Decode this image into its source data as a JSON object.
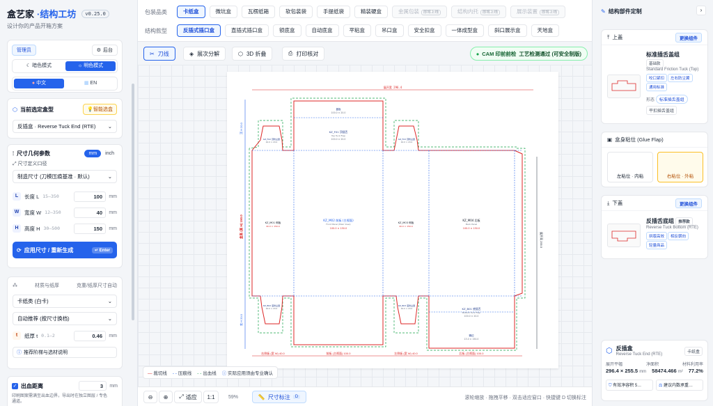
{
  "brand": {
    "name": "盒艺家",
    "product": "·结构工坊",
    "version": "v0.25.0",
    "subtitle": "设计你的产品开箱方案"
  },
  "left": {
    "role": "管理员",
    "backstage": "后台",
    "theme": {
      "dark": "暗色模式",
      "light": "明色模式"
    },
    "lang": {
      "zh": "中文",
      "en": "EN"
    },
    "current_box": {
      "title": "当前选定盒型",
      "smart": "智能选盒",
      "value": "反插盒 · Reverse Tuck End (RTE)"
    },
    "dims": {
      "title": "尺寸几何参数",
      "unit_mm": "mm",
      "unit_inch": "inch",
      "def_label": "尺寸定义口径",
      "def_value": "制造尺寸 (刀模压痕基准 · 默认)",
      "rows": [
        {
          "key": "L",
          "name": "长度 L",
          "range": "15–350",
          "value": "100",
          "unit": "mm"
        },
        {
          "key": "W",
          "name": "宽度 W",
          "range": "12–350",
          "value": "40",
          "unit": "mm"
        },
        {
          "key": "H",
          "name": "高度 H",
          "range": "30–500",
          "value": "150",
          "unit": "mm"
        }
      ],
      "apply": "应用尺寸 / 重新生成",
      "enter": "Enter"
    },
    "material": {
      "title": "材质与纸厚",
      "auto": "克重/纸厚尺寸自动",
      "type": "卡纸类 (白卡)",
      "recommend": "自动推荐 (按尺寸换档)",
      "t_label": "纸厚 t",
      "t_range": "0.1–2",
      "t_value": "0.46",
      "t_unit": "mm",
      "tips": "推荐阶梯与选材说明"
    },
    "bleed": {
      "label": "出血距离",
      "value": "3",
      "unit": "mm",
      "desc1": "印刷图案需满至出血边界，导出时在独立图层 / 专色",
      "desc2": "通道。"
    }
  },
  "top": {
    "cat_label": "包装品类",
    "categories": [
      {
        "label": "卡纸盒",
        "on": true
      },
      {
        "label": "微坑盒"
      },
      {
        "label": "瓦楞纸箱"
      },
      {
        "label": "软包装袋"
      },
      {
        "label": "手提纸袋"
      },
      {
        "label": "精装硬盒"
      },
      {
        "label": "金属包装",
        "tag": "即将上线",
        "dis": true
      },
      {
        "label": "结构内托",
        "tag": "即将上线",
        "dis": true
      },
      {
        "label": "展示装置",
        "tag": "即将上线",
        "dis": true
      }
    ],
    "style_label": "结构款型",
    "styles": [
      {
        "label": "反插式插口盒",
        "on": true
      },
      {
        "label": "直插式插口盒"
      },
      {
        "label": "锁底盒"
      },
      {
        "label": "自动底盒"
      },
      {
        "label": "平粘盒"
      },
      {
        "label": "吊口盒"
      },
      {
        "label": "安全扣盒"
      },
      {
        "label": "一体成型盒"
      },
      {
        "label": "斜口展示盒"
      },
      {
        "label": "天地盒"
      }
    ]
  },
  "toolbar": {
    "knife": "刀线",
    "explode": "展次分解",
    "fold3d": "3D 折叠",
    "print": "打印核对",
    "cam": "CAM 印前前检",
    "cam_status": "工艺检测通过 (可安全制版)"
  },
  "drawing": {
    "overall_w": "展开宽 296.4",
    "overall_h": "展开高 255.5",
    "panels": [
      {
        "code": "盖板",
        "size": "100.0 × 20.0"
      },
      {
        "code": "KZ_F01 顶插舌",
        "sub": "Top Tuck Flap",
        "size": "100.0 × 20.0"
      },
      {
        "code": "KZ_F02 顶防尘翼",
        "size": "40.0 × 20.0"
      },
      {
        "code": "KZ_F03 顶防尘翼",
        "size": "40.0 × 20.0"
      },
      {
        "code": "KZ_M01 侧板",
        "size": "40.0 × 150.0"
      },
      {
        "code": "KZ_M02 前板 (主视面)",
        "sub": "Front Panel (Main View)",
        "size": "100.0 × 150.0"
      },
      {
        "code": "KZ_M03 侧板",
        "size": "40.0 × 150.0"
      },
      {
        "code": "KZ_M04 后板",
        "sub": "Back Panel",
        "size": "100.0 × 150.0"
      },
      {
        "code": "KZ_B02 底防尘翼",
        "size": "40.0 × 20.0"
      },
      {
        "code": "KZ_B03 底防尘翼",
        "size": "40.0 × 20.0"
      },
      {
        "code": "KZ_B01 底插舌",
        "sub": "Bottom Tuck Flap",
        "size": "100.0 × 20.0"
      },
      {
        "code": "糊边",
        "size": "13.0 × 150.0"
      }
    ],
    "bottom_dims": [
      "右侧板 (宽 W) 40.0",
      "前板 (主视面) 100.0",
      "左侧板 (宽 W) 40.0",
      "后板 (主视面) 100.0"
    ],
    "left_dims": [
      "顶 H 20.0",
      "盒高 (高 H) 150.0",
      "底 H 20.0"
    ],
    "right_dim": "展开高 255.5"
  },
  "legend": {
    "cut": "裁切线",
    "crease": "压痕线",
    "bleed": "出血线",
    "note": "实际应用须由专业确认"
  },
  "bottom": {
    "fit": "适应",
    "ratio": "1:1",
    "zoom": "59%",
    "dims": "尺寸标注",
    "dims_key": "D",
    "hint": "滚轮缩放 · 拖拽平移 · 双击适应窗口 · 快捷键 D 切换标注"
  },
  "right": {
    "title": "结构部件定制",
    "top": {
      "label": "上盖",
      "replace": "更换组件",
      "name": "标准插舌盖组",
      "tag": "基础款",
      "en": "Standard Friction Tuck (Top)",
      "pills": [
        "咬口紧扣",
        "左右防尘翼",
        "通用标准"
      ],
      "shape_label": "形态",
      "shapes": [
        "标准插舌盖组",
        "平扣插舌盖组"
      ]
    },
    "glue": {
      "label": "盒身粘位 (Glue Flap)",
      "left": "左粘位 · 内粘",
      "right": "右粘位 · 外粘"
    },
    "bottom": {
      "label": "下盖",
      "replace": "更换组件",
      "name": "反插舌底组",
      "tag": "推荐款",
      "en": "Reverse Tuck Bottom (RTE)",
      "pills": [
        "拼版高效",
        "相反朝向",
        "轻量商品"
      ]
    },
    "summary": {
      "name": "反插盒",
      "en": "Reverse Tuck End (RTE)",
      "badge": "卡纸盒",
      "k1": "展开平幅",
      "v1": "296.4 × 255.5",
      "u1": "mm",
      "k2": "净面积",
      "v2": "58474.466",
      "u2": "m²",
      "k3": "材料利用率",
      "v3": "77.2%",
      "b1": "有效净容积 5…",
      "b2": "建议内数承重…"
    }
  },
  "colors": {
    "accent": "#2563eb",
    "cut": "#dc2626",
    "crease": "#2563eb",
    "bleed": "#16a34a"
  }
}
